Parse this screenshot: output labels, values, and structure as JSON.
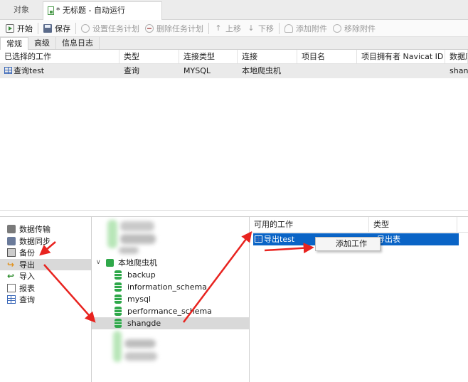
{
  "tabs": {
    "objects": "对象",
    "document": "* 无标题 - 自动运行"
  },
  "toolbar": {
    "start": "开始",
    "save": "保存",
    "set_schedule": "设置任务计划",
    "delete_schedule": "删除任务计划",
    "move_up": "上移",
    "move_down": "下移",
    "add_attachment": "添加附件",
    "remove_attachment": "移除附件"
  },
  "subtabs": [
    "常规",
    "高级",
    "信息日志"
  ],
  "job_table": {
    "columns": [
      "已选择的工作",
      "类型",
      "连接类型",
      "连接",
      "项目名",
      "项目拥有者 Navicat ID",
      "数据库"
    ],
    "rows": [
      {
        "job": "查询test",
        "type": "查询",
        "conn_type": "MYSQL",
        "conn": "本地爬虫机",
        "project": "",
        "owner": "",
        "db": "shangde"
      }
    ]
  },
  "left_panel": {
    "items": [
      {
        "label": "数据传输",
        "icon": "data-transfer-icon"
      },
      {
        "label": "数据同步",
        "icon": "data-sync-icon"
      },
      {
        "label": "备份",
        "icon": "backup-icon"
      },
      {
        "label": "导出",
        "icon": "export-icon",
        "selected": true
      },
      {
        "label": "导入",
        "icon": "import-icon"
      },
      {
        "label": "报表",
        "icon": "report-icon"
      },
      {
        "label": "查询",
        "icon": "query-icon"
      }
    ]
  },
  "tree": {
    "connection": "本地爬虫机",
    "databases": [
      "backup",
      "information_schema",
      "mysql",
      "performance_schema",
      "shangde"
    ],
    "selected": "shangde"
  },
  "available_jobs": {
    "columns": [
      "可用的工作",
      "类型"
    ],
    "rows": [
      {
        "job": "导出test",
        "type": "导出表"
      }
    ]
  },
  "context_menu": {
    "add_job": "添加工作"
  },
  "colors": {
    "selection_blue": "#0a64c6",
    "annotation_red": "#e8231f",
    "db_green": "#2fa84a"
  }
}
